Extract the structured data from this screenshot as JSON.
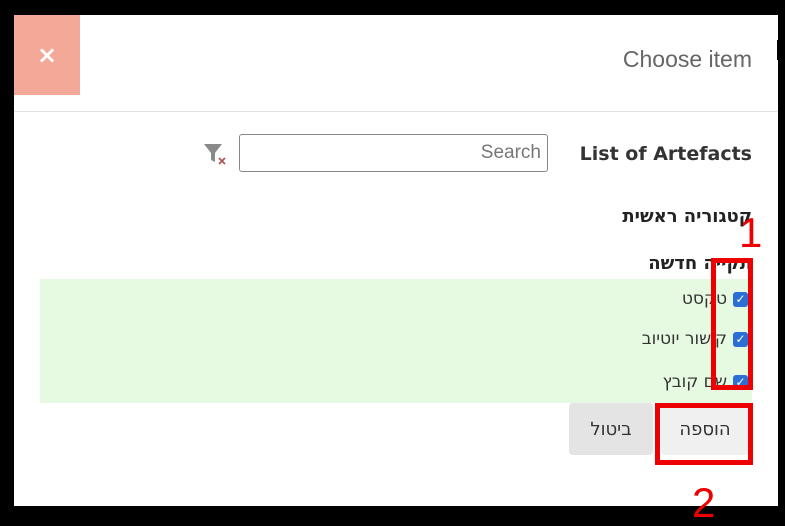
{
  "modal": {
    "close_glyph": "×",
    "title": "Choose item",
    "list_label": "List of Artefacts",
    "search": {
      "placeholder": "Search",
      "value": ""
    },
    "category": "קטגוריה ראשית",
    "subcategory": "תקייה חדשה",
    "items": [
      {
        "label": "טקסט",
        "checked": true
      },
      {
        "label": "קישור יוטיוב",
        "checked": true
      },
      {
        "label": "שם קובץ",
        "checked": true
      }
    ],
    "buttons": {
      "cancel": "ביטול",
      "add": "הוספה"
    }
  },
  "annotations": {
    "step1": "1",
    "step2": "2"
  },
  "colors": {
    "close_bg": "#f4a898",
    "highlight_bg": "#e6f9e1",
    "annotation": "#e00000",
    "checkbox": "#2b6fd6"
  },
  "icons": {
    "filter": "filter-clear-icon",
    "close": "close-icon",
    "checkbox": "checkbox-checked-icon"
  }
}
